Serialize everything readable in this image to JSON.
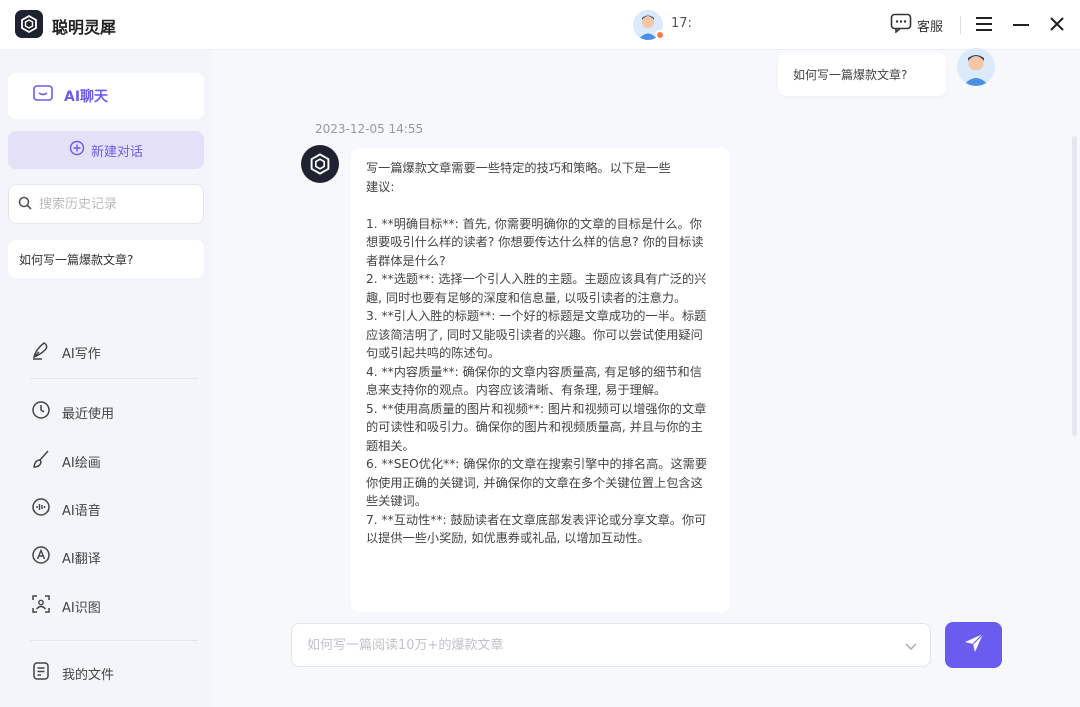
{
  "app": {
    "name": "聪明灵犀"
  },
  "titlebar": {
    "user_phone": "17:",
    "support_label": "客服"
  },
  "sidebar": {
    "chat_label": "AI聊天",
    "new_chat_label": "新建对话",
    "search_placeholder": "搜索历史记录",
    "history": [
      "如何写一篇爆款文章?"
    ],
    "nav": [
      {
        "icon": "pen-icon",
        "label": "AI写作"
      },
      {
        "icon": "clock-icon",
        "label": "最近使用"
      },
      {
        "icon": "brush-icon",
        "label": "AI绘画"
      },
      {
        "icon": "voice-icon",
        "label": "AI语音"
      },
      {
        "icon": "translate-icon",
        "label": "AI翻译"
      },
      {
        "icon": "scan-icon",
        "label": "AI识图"
      },
      {
        "icon": "file-icon",
        "label": "我的文件"
      }
    ]
  },
  "chat": {
    "user_message": "如何写一篇爆款文章?",
    "timestamp": "2023-12-05 14:55",
    "bot_message": "写一篇爆款文章需要一些特定的技巧和策略。以下是一些\n建议:\n\n1. **明确目标**: 首先, 你需要明确你的文章的目标是什么。你想要吸引什么样的读者? 你想要传达什么样的信息? 你的目标读者群体是什么?\n2. **选题**: 选择一个引人入胜的主题。主题应该具有广泛的兴趣, 同时也要有足够的深度和信息量, 以吸引读者的注意力。\n3. **引人入胜的标题**: 一个好的标题是文章成功的一半。标题应该简洁明了, 同时又能吸引读者的兴趣。你可以尝试使用疑问句或引起共鸣的陈述句。\n4. **内容质量**: 确保你的文章内容质量高, 有足够的细节和信息来支持你的观点。内容应该清晰、有条理, 易于理解。\n5. **使用高质量的图片和视频**: 图片和视频可以增强你的文章的可读性和吸引力。确保你的图片和视频质量高, 并且与你的主题相关。\n6. **SEO优化**: 确保你的文章在搜索引擎中的排名高。这需要你使用正确的关键词, 并确保你的文章在多个关键位置上包含这些关键词。\n7. **互动性**: 鼓励读者在文章底部发表评论或分享文章。你可以提供一些小奖励, 如优惠券或礼品, 以增加互动性。"
  },
  "composer": {
    "placeholder": "如何写一篇阅读10万+的爆款文章"
  },
  "colors": {
    "accent": "#6b5cf0",
    "accent_light": "#e3e0f8",
    "logo_bg": "#1f2230"
  }
}
